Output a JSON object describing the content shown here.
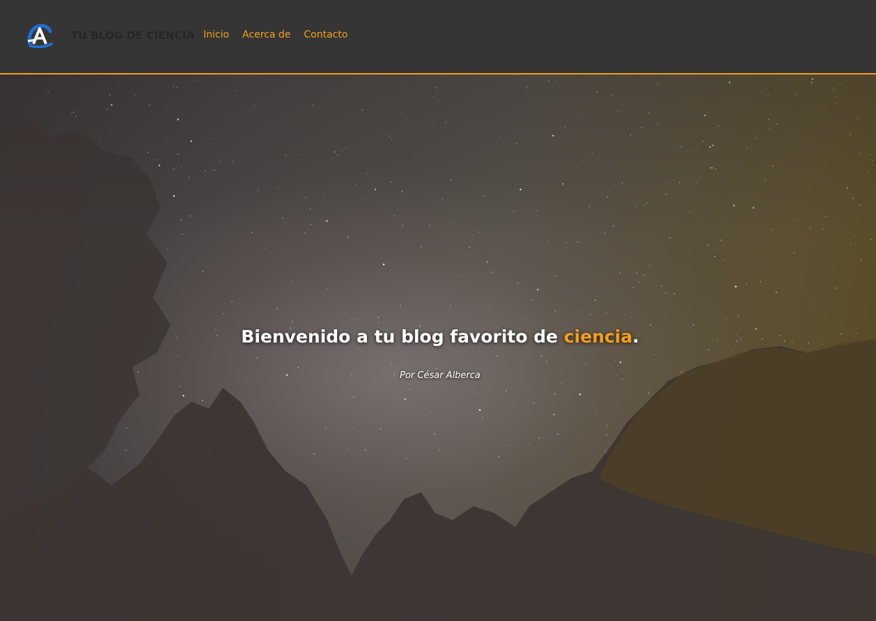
{
  "header": {
    "site_title": "TU BLOG DE CIENCIA",
    "logo_icon": "science-atom-logo-icon",
    "nav": [
      {
        "label": "Inicio"
      },
      {
        "label": "Acerca de"
      },
      {
        "label": "Contacto"
      }
    ]
  },
  "hero": {
    "title_prefix": "Bienvenido a tu blog favorito de ",
    "title_accent": "ciencia",
    "title_suffix": ".",
    "byline": "Por César Alberca"
  },
  "colors": {
    "accent": "#f4a019",
    "header_bg": "#353535",
    "header_border": "#f0a020",
    "site_title": "#262626",
    "hero_text": "#ffffff"
  }
}
